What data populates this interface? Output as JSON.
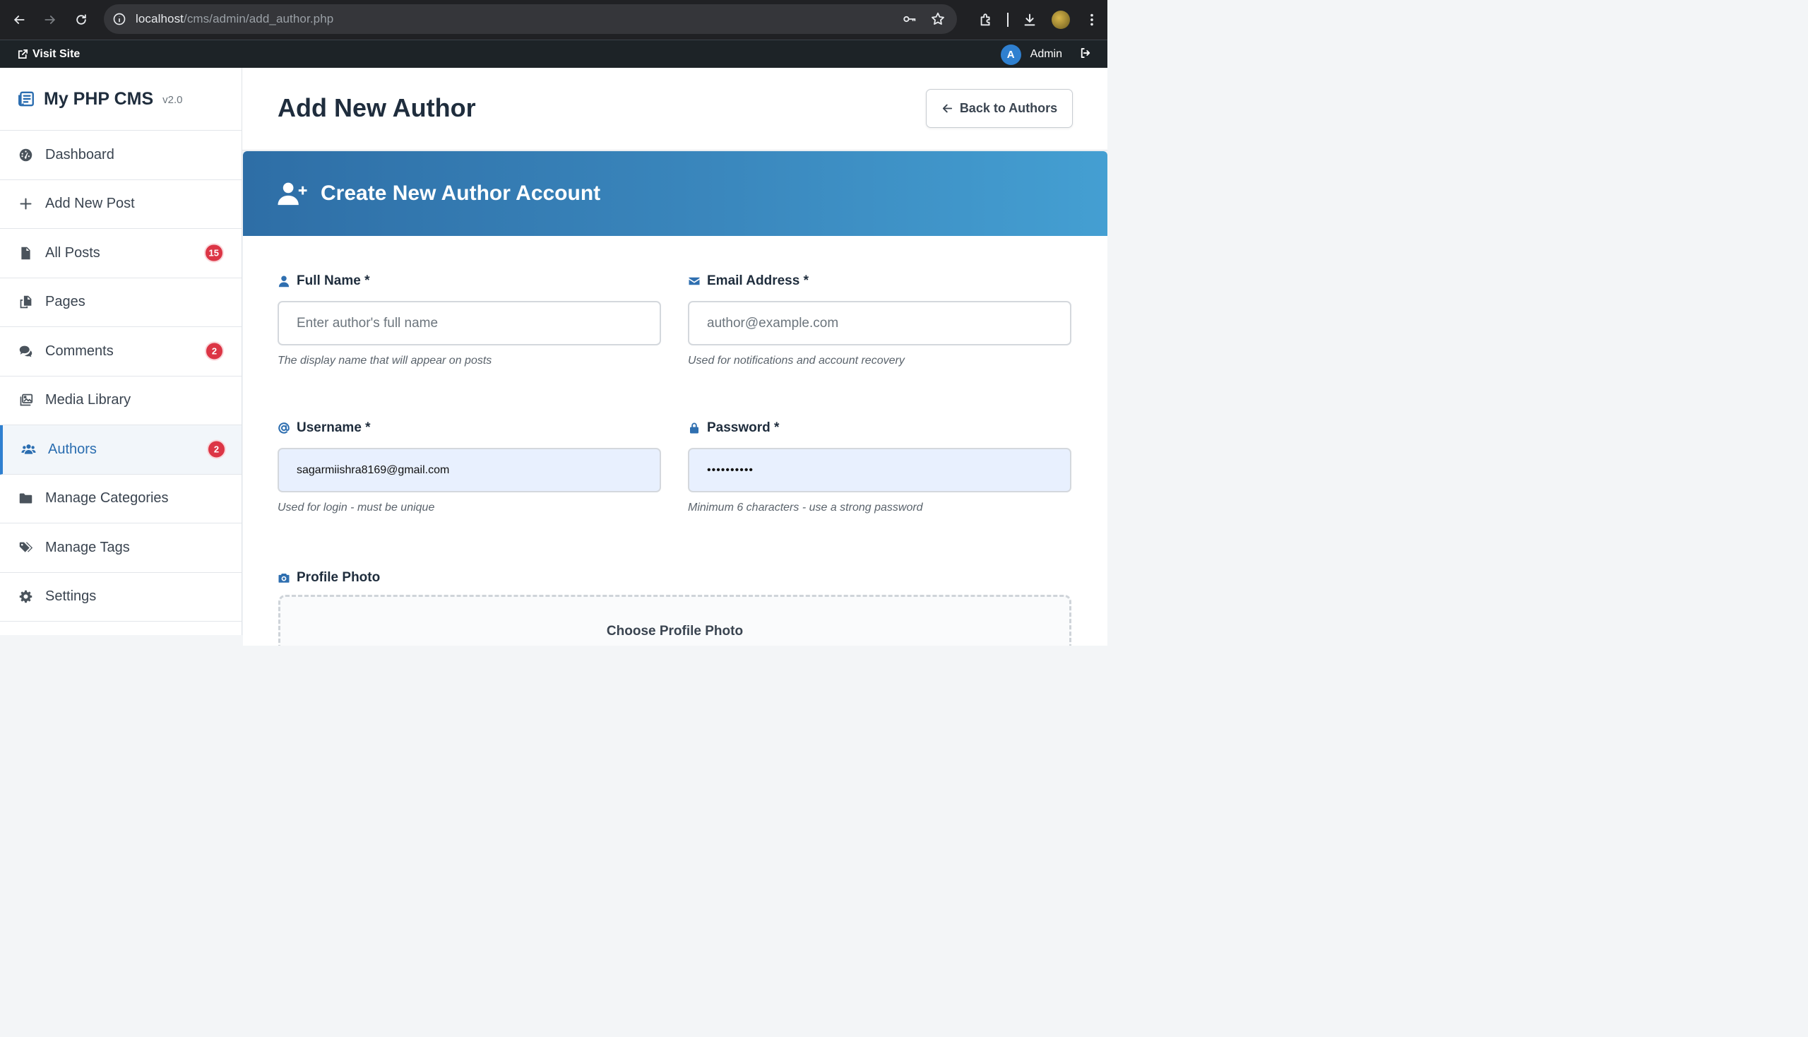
{
  "browser": {
    "url_host": "localhost",
    "url_path": "/cms/admin/add_author.php"
  },
  "adminbar": {
    "visit_site": "Visit Site",
    "avatar_initial": "A",
    "user_name": "Admin"
  },
  "brand": {
    "name": "My PHP CMS",
    "version": "v2.0"
  },
  "sidebar": {
    "items": [
      {
        "label": "Dashboard",
        "icon": "dashboard-icon",
        "badge": ""
      },
      {
        "label": "Add New Post",
        "icon": "plus-icon",
        "badge": ""
      },
      {
        "label": "All Posts",
        "icon": "file-icon",
        "badge": "15"
      },
      {
        "label": "Pages",
        "icon": "copy-icon",
        "badge": ""
      },
      {
        "label": "Comments",
        "icon": "comments-icon",
        "badge": "2"
      },
      {
        "label": "Media Library",
        "icon": "images-icon",
        "badge": ""
      },
      {
        "label": "Authors",
        "icon": "users-icon",
        "badge": "2",
        "active": true
      },
      {
        "label": "Manage Categories",
        "icon": "folder-icon",
        "badge": ""
      },
      {
        "label": "Manage Tags",
        "icon": "tags-icon",
        "badge": ""
      },
      {
        "label": "Settings",
        "icon": "gear-icon",
        "badge": ""
      }
    ]
  },
  "page": {
    "title": "Add New Author",
    "back_button": "Back to Authors"
  },
  "card": {
    "title": "Create New Author Account"
  },
  "form": {
    "full_name": {
      "label": "Full Name *",
      "placeholder": "Enter author's full name",
      "value": "",
      "help": "The display name that will appear on posts"
    },
    "email": {
      "label": "Email Address *",
      "placeholder": "author@example.com",
      "value": "",
      "help": "Used for notifications and account recovery"
    },
    "username": {
      "label": "Username *",
      "value": "sagarmiishra8169@gmail.com",
      "help": "Used for login - must be unique"
    },
    "password": {
      "label": "Password *",
      "value": "••••••••••",
      "help": "Minimum 6 characters - use a strong password"
    },
    "photo": {
      "label": "Profile Photo",
      "dropzone_text": "Choose Profile Photo"
    }
  },
  "colors": {
    "accent": "#2f80d0",
    "header_gradient_start": "#2e6ea6",
    "header_gradient_end": "#449fd2",
    "badge": "#dc3545",
    "adminbar": "#1d2327"
  }
}
